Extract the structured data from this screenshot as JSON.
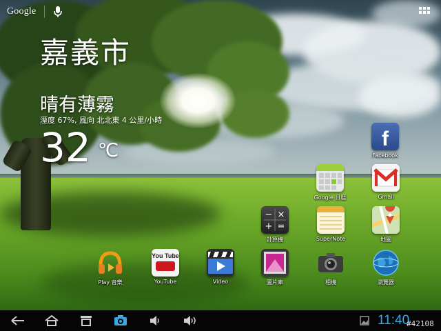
{
  "search_bar": {
    "brand": "Google",
    "icons": [
      "mic-icon",
      "app-drawer-icon"
    ]
  },
  "weather": {
    "city": "嘉義市",
    "condition": "晴有薄霧",
    "details": "溼度 67%, 風向 北北東 4 公里/小時",
    "temperature": "32",
    "unit": "℃"
  },
  "apps": {
    "facebook": "Facebook",
    "calendar": "Google 日曆",
    "gmail": "Gmail",
    "calculator": "計算機",
    "supernote": "SuperNote",
    "maps": "地圖",
    "play_music": "Play 音樂",
    "youtube": "YouTube",
    "video": "Video",
    "gallery": "圖片庫",
    "camera": "相機",
    "browser": "瀏覽器",
    "youtube_logo": "You Tube"
  },
  "navbar": {
    "buttons": [
      "back-icon",
      "home-icon",
      "recent-apps-icon",
      "screenshot-icon",
      "volume-down-icon",
      "volume-up-icon"
    ],
    "clock": "11:40",
    "tag": "#42108"
  },
  "colors": {
    "clock": "#38a9e5",
    "navbar": "#050505",
    "grass": "#6fab2a",
    "sky": "#4c6672"
  }
}
